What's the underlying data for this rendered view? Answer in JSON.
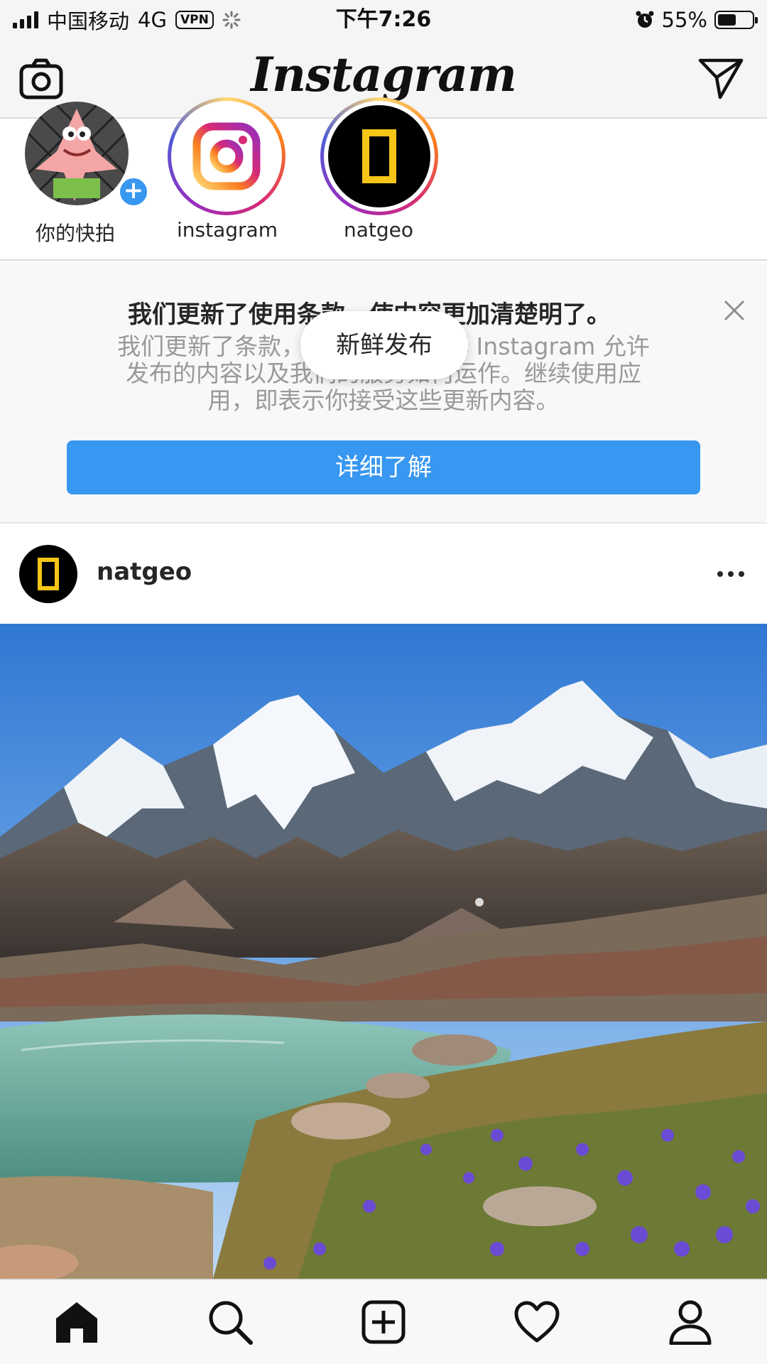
{
  "status_bar": {
    "carrier": "中国移动",
    "network": "4G",
    "vpn": "VPN",
    "time": "下午7:26",
    "battery": "55%",
    "battery_level": 0.55
  },
  "nav": {
    "logo": "Instagram",
    "left_icon": "camera-icon",
    "right_icon": "direct-message-icon"
  },
  "stories": [
    {
      "label": "你的快拍",
      "badge": "+"
    },
    {
      "label": "instagram"
    },
    {
      "label": "natgeo"
    }
  ],
  "terms_banner": {
    "title": "我们更新了使用条款，使内容更加清楚明了。",
    "body_line1": "我们更新了条款，让你更好地了解 Instagram 允许",
    "body_line2": "发布的内容以及我们的服务如何运作。继续使用应",
    "body_line3": "用，即表示你接受这些更新内容。",
    "button_label": "详细了解",
    "close_icon": "close-icon"
  },
  "toast": {
    "label": "新鲜发布"
  },
  "post": {
    "username": "natgeo",
    "more_icon": "more-options-icon"
  },
  "tab_bar": {
    "items": [
      "home-icon",
      "search-icon",
      "new-post-icon",
      "activity-heart-icon",
      "profile-icon"
    ]
  },
  "colors": {
    "accent": "#3897f0",
    "background": "#f5f5f5",
    "text": "#262626",
    "muted": "#999999"
  }
}
